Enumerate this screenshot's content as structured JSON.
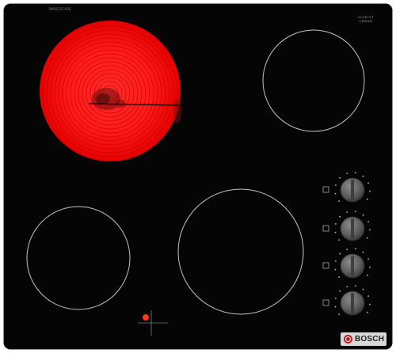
{
  "product": {
    "model_code": "PKE611CA3E",
    "glass_brand": "SCHOTT CERAN",
    "brand": "BOSCH"
  },
  "zones": [
    {
      "name": "front-left",
      "state": "off"
    },
    {
      "name": "rear-left",
      "state": "on"
    },
    {
      "name": "front-right",
      "state": "off"
    },
    {
      "name": "rear-right",
      "state": "off"
    }
  ],
  "knobs": [
    {
      "position": "rear-left"
    },
    {
      "position": "front-left"
    },
    {
      "position": "rear-right"
    },
    {
      "position": "front-right"
    }
  ],
  "indicator": {
    "state": "on",
    "color": "#ff3a1a"
  },
  "colors": {
    "glass": "#050505",
    "zone_ring": "#c4c4c4",
    "heating": "#ff1a1a",
    "knob_body": "#616161"
  },
  "icons": [
    "cooktop-glass",
    "heating-zone",
    "knob-icon",
    "zone-symbol-icon",
    "bosch-logo-icon",
    "residual-heat-indicator"
  ]
}
